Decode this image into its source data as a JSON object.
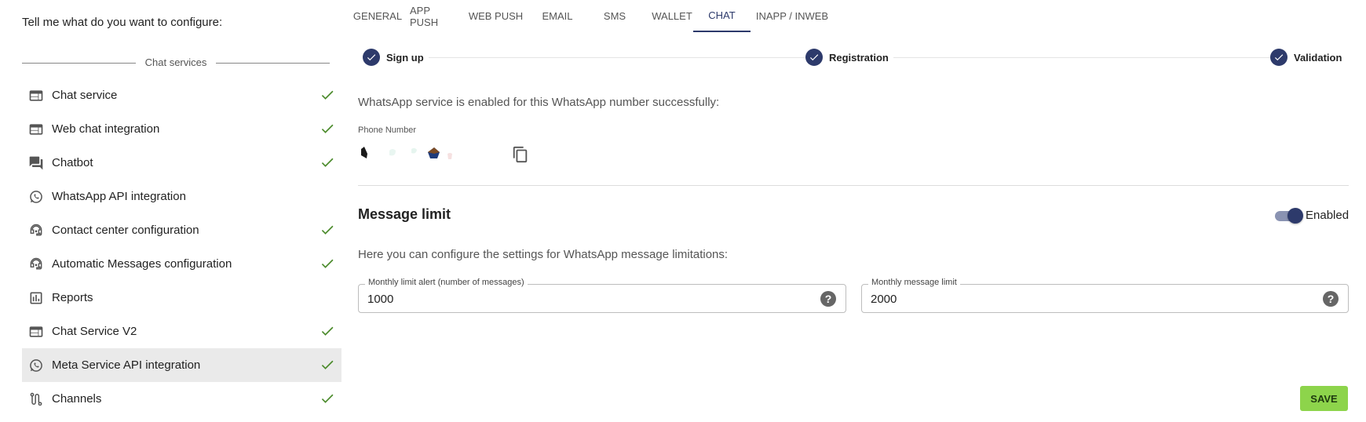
{
  "left": {
    "intro": "Tell me what do you want to configure:",
    "section_label": "Chat services",
    "items": [
      {
        "label": "Chat service",
        "icon": "web-window-icon",
        "checked": true,
        "active": false
      },
      {
        "label": "Web chat integration",
        "icon": "web-window-icon",
        "checked": true,
        "active": false
      },
      {
        "label": "Chatbot",
        "icon": "forum-icon",
        "checked": true,
        "active": false
      },
      {
        "label": "WhatsApp API integration",
        "icon": "whatsapp-icon",
        "checked": false,
        "active": false
      },
      {
        "label": "Contact center configuration",
        "icon": "support-agent-icon",
        "checked": true,
        "active": false
      },
      {
        "label": "Automatic Messages configuration",
        "icon": "support-agent-icon",
        "checked": true,
        "active": false
      },
      {
        "label": "Reports",
        "icon": "bar-chart-icon",
        "checked": false,
        "active": false
      },
      {
        "label": "Chat Service V2",
        "icon": "web-window-icon",
        "checked": true,
        "active": false
      },
      {
        "label": "Meta Service API integration",
        "icon": "whatsapp-icon",
        "checked": true,
        "active": true
      },
      {
        "label": "Channels",
        "icon": "route-icon",
        "checked": true,
        "active": false
      }
    ]
  },
  "tabs": [
    {
      "label": "GENERAL",
      "active": false
    },
    {
      "label": "APP PUSH",
      "active": false
    },
    {
      "label": "WEB PUSH",
      "active": false
    },
    {
      "label": "EMAIL",
      "active": false
    },
    {
      "label": "SMS",
      "active": false
    },
    {
      "label": "WALLET",
      "active": false
    },
    {
      "label": "CHAT",
      "active": true
    },
    {
      "label": "INAPP / INWEB",
      "active": false
    }
  ],
  "stepper": {
    "steps": [
      {
        "label": "Sign up",
        "completed": true
      },
      {
        "label": "Registration",
        "completed": true
      },
      {
        "label": "Validation",
        "completed": true
      }
    ]
  },
  "main": {
    "success_text": "WhatsApp service is enabled for this WhatsApp number successfully:",
    "phone_label": "Phone Number",
    "message_limit": {
      "title": "Message limit",
      "toggle_label": "Enabled",
      "toggle_on": true,
      "description": "Here you can configure the settings for WhatsApp message limitations:",
      "monthly_alert": {
        "label": "Monthly limit alert (number of messages)",
        "value": "1000"
      },
      "monthly_limit": {
        "label": "Monthly message limit",
        "value": "2000"
      }
    },
    "save_label": "SAVE"
  },
  "colors": {
    "accent": "#2d3a6b",
    "check": "#4a8a2a",
    "save_button": "#8dd44b",
    "active_row": "#eaeaea"
  }
}
